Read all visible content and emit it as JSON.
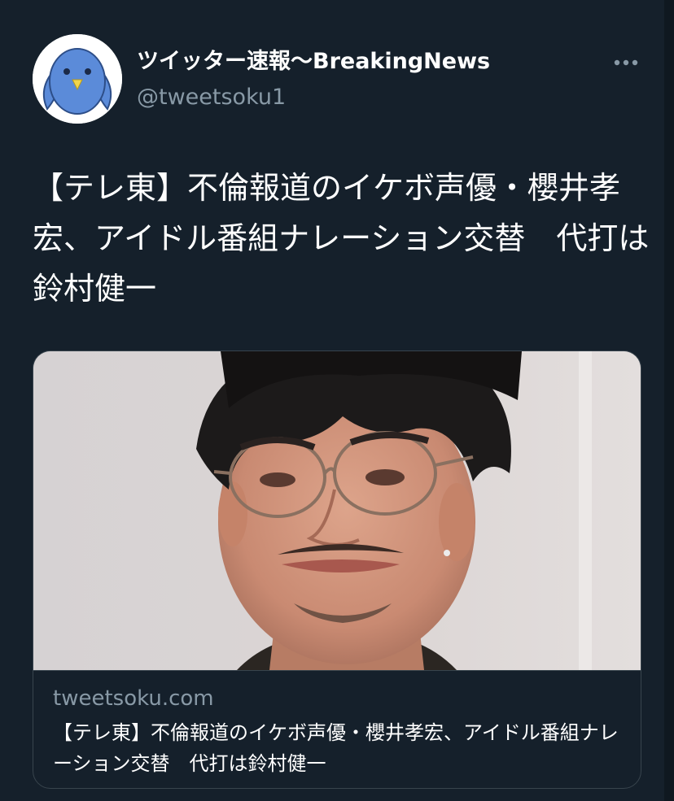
{
  "tweet": {
    "author": {
      "display_name": "ツイッター速報〜BreakingNews",
      "handle": "@tweetsoku1",
      "avatar_icon": "bird-avatar-icon"
    },
    "more_icon": "more-options-icon",
    "text": "【テレ東】不倫報道のイケボ声優・櫻井孝宏、アイドル番組ナレーション交替　代打は鈴村健一",
    "card": {
      "domain": "tweetsoku.com",
      "title": "【テレ東】不倫報道のイケボ声優・櫻井孝宏、アイドル番組ナレーション交替　代打は鈴村健一"
    }
  },
  "colors": {
    "background": "#15202b",
    "text_primary": "#ffffff",
    "text_secondary": "#8899a6",
    "border": "#38444d",
    "avatar_bird": "#5b8bd9"
  }
}
